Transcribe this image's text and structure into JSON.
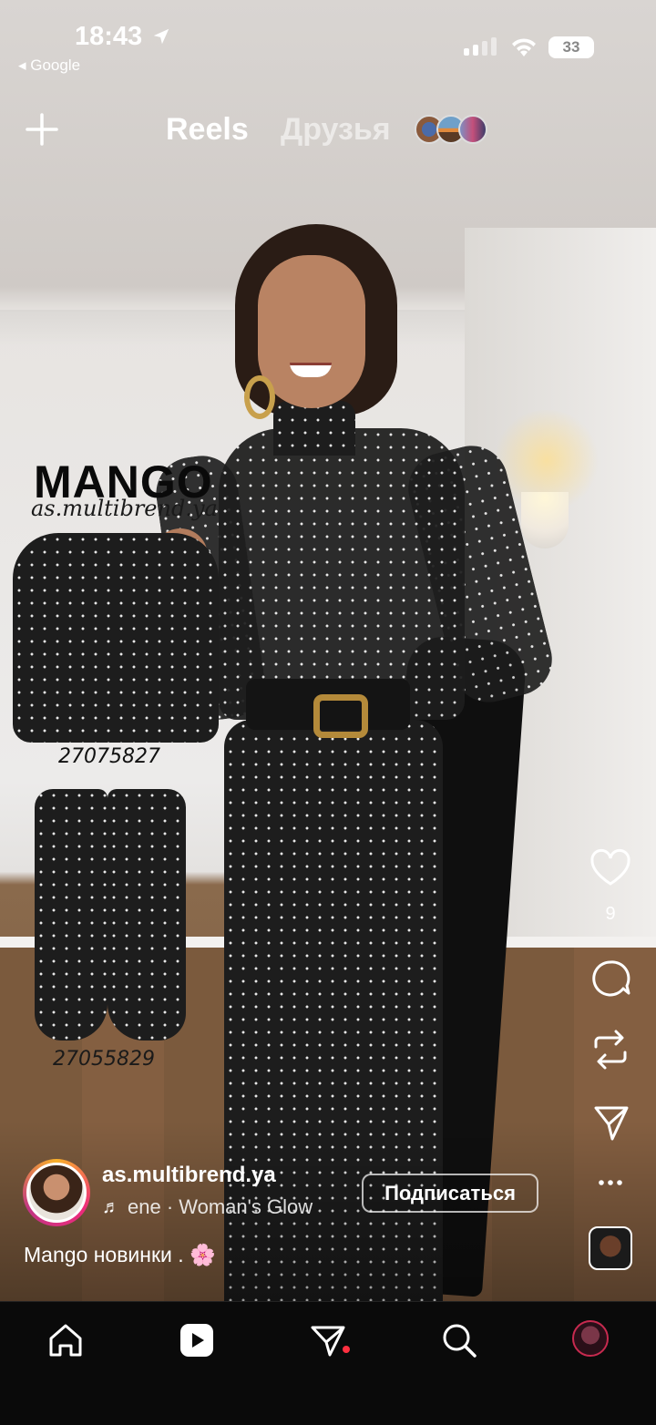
{
  "status_bar": {
    "time": "18:43",
    "back_app": "◂ Google",
    "battery": "33"
  },
  "top_nav": {
    "tabs": [
      {
        "label": "Reels",
        "active": true
      },
      {
        "label": "Друзья",
        "active": false
      }
    ]
  },
  "overlay": {
    "brand": "MANGO",
    "handle": "as.multibrend.ya",
    "item_codes": [
      "27075827",
      "27055829"
    ]
  },
  "actions": {
    "like_count": "9",
    "icons": [
      "heart-icon",
      "comment-icon",
      "repost-icon",
      "share-icon",
      "more-icon"
    ]
  },
  "post": {
    "username": "as.multibrend.ya",
    "music": "ene · Woman's Glow",
    "follow_label": "Подписаться",
    "caption": "Mango новинки . 🌸"
  },
  "tabbar": {
    "items": [
      "home-icon",
      "reels-icon",
      "messages-icon",
      "search-icon",
      "profile-avatar"
    ]
  },
  "colors": {
    "notification": "#ff3040",
    "tabbar_bg": "#0a0a0a"
  }
}
